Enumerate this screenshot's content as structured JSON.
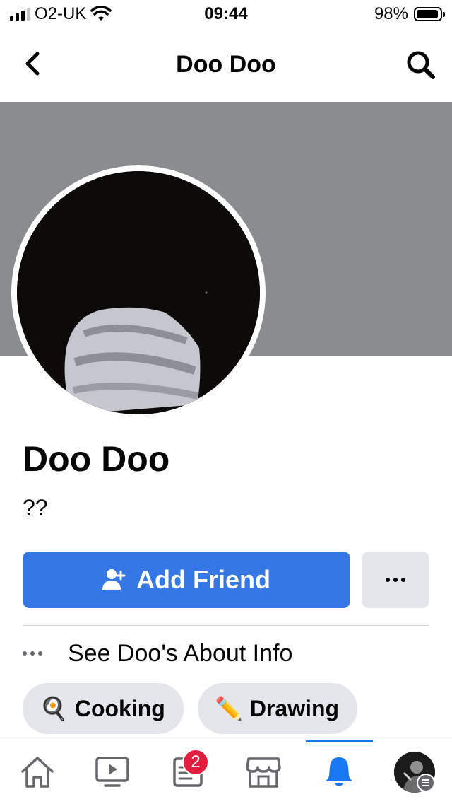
{
  "status_bar": {
    "carrier": "O2-UK",
    "time": "09:44",
    "battery": "98%"
  },
  "header": {
    "title": "Doo Doo"
  },
  "profile": {
    "name": "Doo Doo",
    "bio": "??"
  },
  "actions": {
    "add_friend_label": "Add Friend"
  },
  "about": {
    "label": "See Doo's About Info"
  },
  "interests": [
    {
      "label": "Cooking",
      "emoji": "🍳"
    },
    {
      "label": "Drawing",
      "emoji": "✏️"
    }
  ],
  "tab_bar": {
    "active_tab": "notifications",
    "feeds_badge": "2"
  },
  "colors": {
    "accent": "#3578e5",
    "badge": "#e41e3f",
    "cover": "#8b8c90"
  }
}
